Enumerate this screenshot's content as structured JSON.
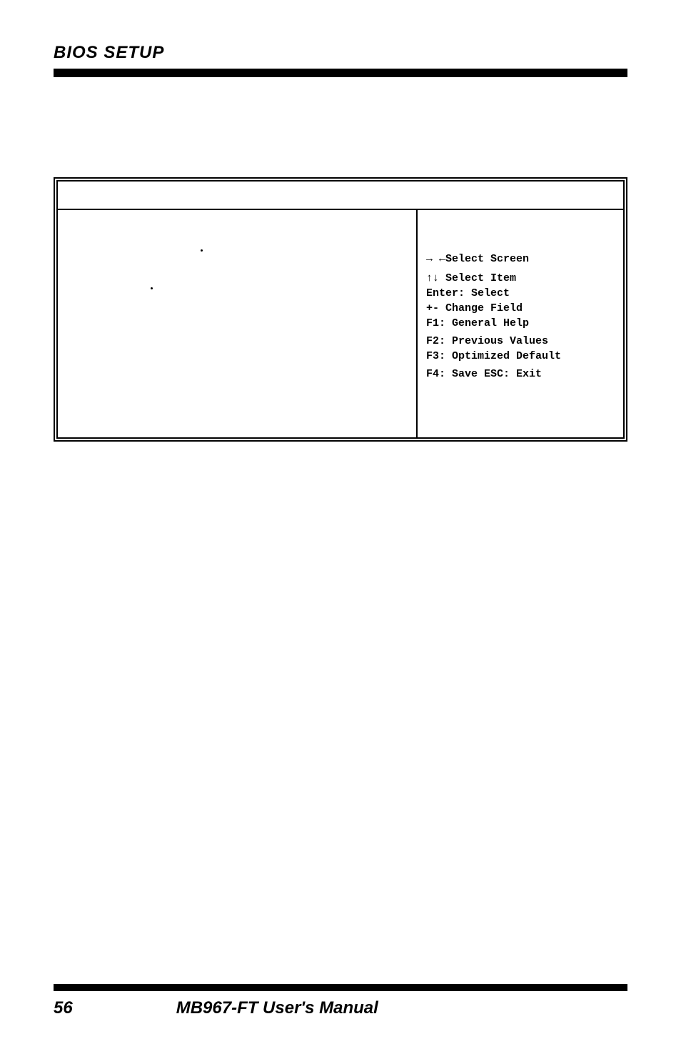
{
  "header": {
    "title": "BIOS SETUP"
  },
  "bios": {
    "help": {
      "select_screen": "→ ←Select Screen",
      "select_item": "↑↓ Select Item",
      "enter": "Enter: Select",
      "change_field": "+-  Change Field",
      "general_help": "F1: General Help",
      "previous_values": "F2: Previous Values",
      "optimized_default": "F3: Optimized Default",
      "save_exit": "F4: Save  ESC: Exit"
    }
  },
  "footer": {
    "page_number": "56",
    "manual_title": "MB967-FT User's Manual"
  }
}
